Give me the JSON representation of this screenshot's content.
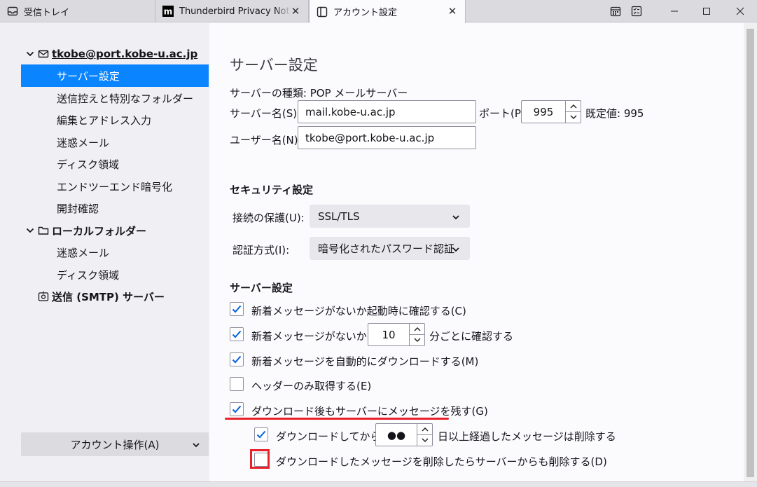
{
  "tabs": [
    {
      "label": "受信トレイ",
      "icon": "inbox-icon"
    },
    {
      "label": "Thunderbird Privacy Notice — Mozilla",
      "icon": "mozilla-icon"
    },
    {
      "label": "アカウント設定",
      "icon": "settings-icon"
    }
  ],
  "sidebar": {
    "account": "tkobe@port.kobe-u.ac.jp",
    "account_items": [
      "サーバー設定",
      "送信控えと特別なフォルダー",
      "編集とアドレス入力",
      "迷惑メール",
      "ディスク領域",
      "エンドツーエンド暗号化",
      "開封確認"
    ],
    "local_folders": "ローカルフォルダー",
    "local_items": [
      "迷惑メール",
      "ディスク領域"
    ],
    "smtp": "送信 (SMTP) サーバー",
    "account_actions": "アカウント操作(A)"
  },
  "main": {
    "title": "サーバー設定",
    "server_type_label": "サーバーの種類:",
    "server_type_value": "POP メールサーバー",
    "server_name_label": "サーバー名(S):",
    "server_name_value": "mail.kobe-u.ac.jp",
    "port_label": "ポート(P):",
    "port_value": "995",
    "default_label": "既定値: 995",
    "username_label": "ユーザー名(N):",
    "username_value": "tkobe@port.kobe-u.ac.jp",
    "security_title": "セキュリティ設定",
    "connection_label": "接続の保護(U):",
    "connection_value": "SSL/TLS",
    "auth_label": "認証方式(I):",
    "auth_value": "暗号化されたパスワード認証",
    "server_settings_title": "サーバー設定",
    "check_startup": "新着メッセージがないか起動時に確認する(C)",
    "check_every": "新着メッセージがないか(Y)",
    "check_every_value": "10",
    "check_every_suffix": "分ごとに確認する",
    "auto_download": "新着メッセージを自動的にダウンロードする(M)",
    "headers_only": "ヘッダーのみ取得する(E)",
    "leave_on_server": "ダウンロード後もサーバーにメッセージを残す(G)",
    "delete_after": "ダウンロードしてから(O)",
    "delete_after_value": "●●",
    "delete_after_suffix": "日以上経過したメッセージは削除する",
    "delete_when_deleted": "ダウンロードしたメッセージを削除したらサーバーからも削除する(D)"
  },
  "colors": {
    "selected": "#0a84ff",
    "highlight": "#e8212b",
    "checkmark": "#0061e0"
  }
}
